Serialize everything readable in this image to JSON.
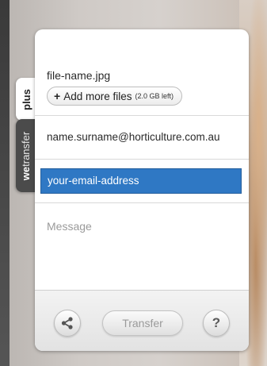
{
  "tabs": {
    "plus_label": "plus",
    "wetransfer_label_bold": "we",
    "wetransfer_label_rest": "transfer"
  },
  "files": {
    "file_name": "file-name.jpg",
    "add_more_symbol": "+",
    "add_more_label": "Add more files",
    "quota_text": "(2.0 GB left)"
  },
  "recipient": {
    "email": "name.surname@horticulture.com.au"
  },
  "sender": {
    "placeholder": "your-email-address",
    "highlight_color": "#2f78c4"
  },
  "message": {
    "placeholder": "Message"
  },
  "footer": {
    "share_icon": "share-icon",
    "transfer_label": "Transfer",
    "help_symbol": "?"
  }
}
